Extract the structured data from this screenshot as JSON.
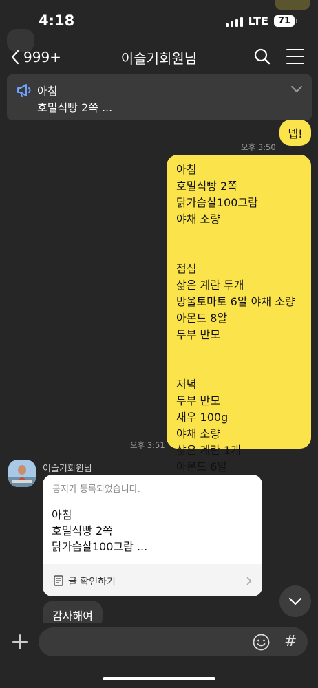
{
  "status_bar": {
    "time": "4:18",
    "network": "LTE",
    "battery": "71"
  },
  "header": {
    "back_count": "999+",
    "title": "이슬기회원님",
    "back_icon": "chevron-left-icon",
    "search_icon": "search-icon",
    "menu_icon": "hamburger-menu-icon"
  },
  "notice_banner": {
    "icon": "megaphone-icon",
    "title": "아침",
    "text": "호밀식빵 2쪽 ..."
  },
  "messages": {
    "reply_first": "넵!",
    "time_first": "오후 3:50",
    "meal_plan_lines": [
      "아침",
      "호밀식빵 2쪽",
      "닭가슴살100그람",
      "야채 소량",
      "",
      "",
      "점심",
      "삶은 계란 두개",
      "방울토마토 6알 야채 소량",
      "아몬드 8알",
      "두부 반모",
      "",
      "",
      "저녁",
      "두부 반모",
      "새우 100g",
      "야채 소량",
      "삶은 계란 1개",
      "아몬드 6알"
    ],
    "time_second": "오후 3:51",
    "sender_name": "이슬기회원님",
    "notice_card": {
      "header": "공지가 등록되었습니다.",
      "body_lines": [
        "아침",
        "호밀식빵 2쪽",
        "닭가슴살100그람 ..."
      ],
      "footer_label": "글 확인하기"
    },
    "reply_second": "감사해여"
  },
  "colors": {
    "background": "#262626",
    "my_bubble": "#fbe44b",
    "other_bubble": "#3a3a3a",
    "notice_bg": "#3a3a3a"
  }
}
